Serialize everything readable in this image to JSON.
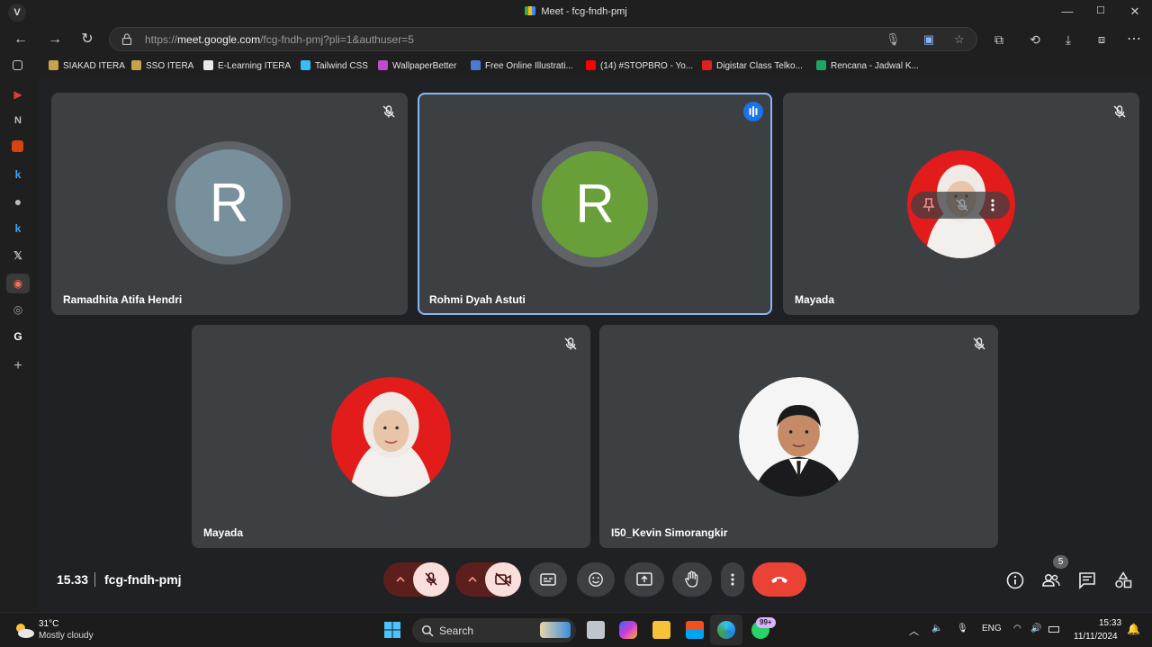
{
  "window": {
    "title": "Meet - fcg-fndh-pmj",
    "controls": [
      "—",
      "☐",
      "✕"
    ]
  },
  "browser": {
    "url_scheme": "https://",
    "url_host": "meet.google.com",
    "url_path": "/fcg-fndh-pmj?pli=1&authuser=5"
  },
  "favorites": [
    {
      "label": "SIAKAD ITERA",
      "color": "#c8a24a"
    },
    {
      "label": "SSO ITERA",
      "color": "#c8a24a"
    },
    {
      "label": "E-Learning ITERA",
      "color": "#e8e8e8"
    },
    {
      "label": "Tailwind CSS",
      "color": "#38bdf8"
    },
    {
      "label": "WallpaperBetter",
      "color": "#c04ad0"
    },
    {
      "label": "Free Online Illustrati...",
      "color": "#4a7bd0"
    },
    {
      "label": "(14) #STOPBRO - Yo...",
      "color": "#ff0000"
    },
    {
      "label": "Digistar Class Telko...",
      "color": "#e02020"
    },
    {
      "label": "Rencana - Jadwal K...",
      "color": "#1fa463"
    }
  ],
  "sidebar_icons": [
    "tabs-icon",
    "youtube-icon",
    "notion-icon",
    "gallery-icon",
    "k-icon",
    "github-icon",
    "k2-icon",
    "x-icon",
    "record-icon",
    "chrome-icon",
    "google-icon",
    "add-icon"
  ],
  "participants": [
    {
      "name": "Ramadhita Atifa Hendri",
      "initial": "R",
      "avatar_color": "#78909c"
    },
    {
      "name": "Rohmi Dyah Astuti",
      "initial": "R",
      "avatar_color": "#689f38"
    },
    {
      "name": "Mayada",
      "photo": "hijab"
    },
    {
      "name": "Mayada",
      "photo": "hijab"
    },
    {
      "name": "I50_Kevin Simorangkir",
      "photo": "suit"
    }
  ],
  "meeting": {
    "time": "15.33",
    "code": "fcg-fndh-pmj",
    "participant_count": "5"
  },
  "taskbar": {
    "temp": "31°C",
    "weather": "Mostly cloudy",
    "search": "Search",
    "lang": "ENG",
    "notif_badge": "99+",
    "clock": "15:33",
    "date": "11/11/2024"
  },
  "colors": {
    "end_call": "#ea4335",
    "speaking_outline": "#8ab4f8",
    "tile_bg": "#3c4043"
  }
}
